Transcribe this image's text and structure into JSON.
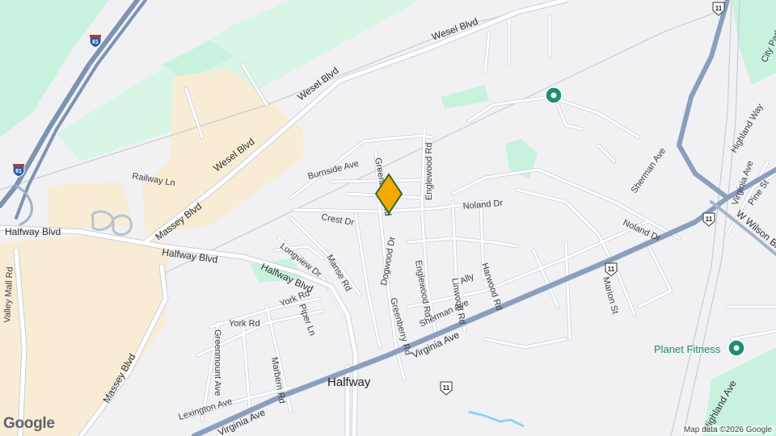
{
  "map": {
    "town_label": "Halfway",
    "attribution": "Map data ©2026 Google",
    "logo": "Google",
    "marker": {
      "icon": "location-pin-icon",
      "color": "#f5a800"
    },
    "colors": {
      "background": "#f1f1f4",
      "park": "#c9f2de",
      "commercial": "#f8ecd4",
      "highway": "#7d93b2",
      "road": "#ffffff",
      "road_outline": "#c9ced6",
      "water": "#8fd3f5",
      "poi_green": "#1e8e6e"
    },
    "roads": [
      {
        "name": "Wesel Blvd",
        "id": "wesel-blvd-east"
      },
      {
        "name": "Wesel Blvd",
        "id": "wesel-blvd-mid"
      },
      {
        "name": "Wesel Blvd",
        "id": "wesel-blvd-west"
      },
      {
        "name": "Massey Blvd",
        "id": "massey-blvd-north"
      },
      {
        "name": "Massey Blvd",
        "id": "massey-blvd-south"
      },
      {
        "name": "Railway Ln",
        "id": "railway-ln"
      },
      {
        "name": "Halfway Blvd",
        "id": "halfway-blvd-west"
      },
      {
        "name": "Halfway Blvd",
        "id": "halfway-blvd-mid"
      },
      {
        "name": "Halfway Blvd",
        "id": "halfway-blvd-east"
      },
      {
        "name": "Burnside Ave",
        "id": "burnside-ave"
      },
      {
        "name": "Greenberry Rd",
        "id": "greenberry-rd-north"
      },
      {
        "name": "Englewood Rd",
        "id": "englewood-rd-north"
      },
      {
        "name": "Noland Dr",
        "id": "noland-dr-west"
      },
      {
        "name": "Noland Dr",
        "id": "noland-dr-east"
      },
      {
        "name": "Crest Dr",
        "id": "crest-dr"
      },
      {
        "name": "Longview Dr",
        "id": "longview-dr"
      },
      {
        "name": "Manse Rd",
        "id": "manse-rd"
      },
      {
        "name": "Dogwood Dr",
        "id": "dogwood-dr"
      },
      {
        "name": "Englewood Rd",
        "id": "englewood-rd-south"
      },
      {
        "name": "Linwood Rd",
        "id": "linwood-rd"
      },
      {
        "name": "Harwood Rd",
        "id": "harwood-rd"
      },
      {
        "name": "Ally",
        "id": "ally"
      },
      {
        "name": "Sherman Ave",
        "id": "sherman-ave-west"
      },
      {
        "name": "Sherman Ave",
        "id": "sherman-ave-east"
      },
      {
        "name": "Greenberry Rd",
        "id": "greenberry-rd-south"
      },
      {
        "name": "York Rd",
        "id": "york-rd-east"
      },
      {
        "name": "York Rd",
        "id": "york-rd-west"
      },
      {
        "name": "Piper Ln",
        "id": "piper-ln"
      },
      {
        "name": "Greenmount Ave",
        "id": "greenmount-ave"
      },
      {
        "name": "Marbern Rd",
        "id": "marbern-rd"
      },
      {
        "name": "Lexington Ave",
        "id": "lexington-ave"
      },
      {
        "name": "Virginia Ave",
        "id": "virginia-ave-mid"
      },
      {
        "name": "Virginia Ave",
        "id": "virginia-ave-west"
      },
      {
        "name": "Marion St",
        "id": "marion-st"
      },
      {
        "name": "Valley Mall Rd",
        "id": "valley-mall-rd"
      },
      {
        "name": "Massey Blvd",
        "id": "massey-blvd-southwest"
      },
      {
        "name": "City Park Dr",
        "id": "city-park-dr"
      },
      {
        "name": "Highland Way",
        "id": "highland-way"
      },
      {
        "name": "Pine St",
        "id": "pine-st"
      },
      {
        "name": "Virginia Ave",
        "id": "virginia-ave-east"
      },
      {
        "name": "W Wilson Blvd",
        "id": "w-wilson-blvd"
      },
      {
        "name": "Highland Ave",
        "id": "highland-ave"
      }
    ],
    "shields": [
      {
        "type": "interstate",
        "number": "81",
        "id": "i81-north"
      },
      {
        "type": "interstate",
        "number": "81",
        "id": "i81-south"
      },
      {
        "type": "us",
        "number": "11",
        "id": "us11-ne"
      },
      {
        "type": "us",
        "number": "11",
        "id": "us11-east"
      },
      {
        "type": "us",
        "number": "11",
        "id": "us11-mid"
      },
      {
        "type": "us",
        "number": "11",
        "id": "us11-center"
      }
    ],
    "pois": [
      {
        "name": "Planet Fitness",
        "icon": "gym-pin-icon"
      },
      {
        "name": "",
        "icon": "green-poi-icon"
      }
    ]
  }
}
